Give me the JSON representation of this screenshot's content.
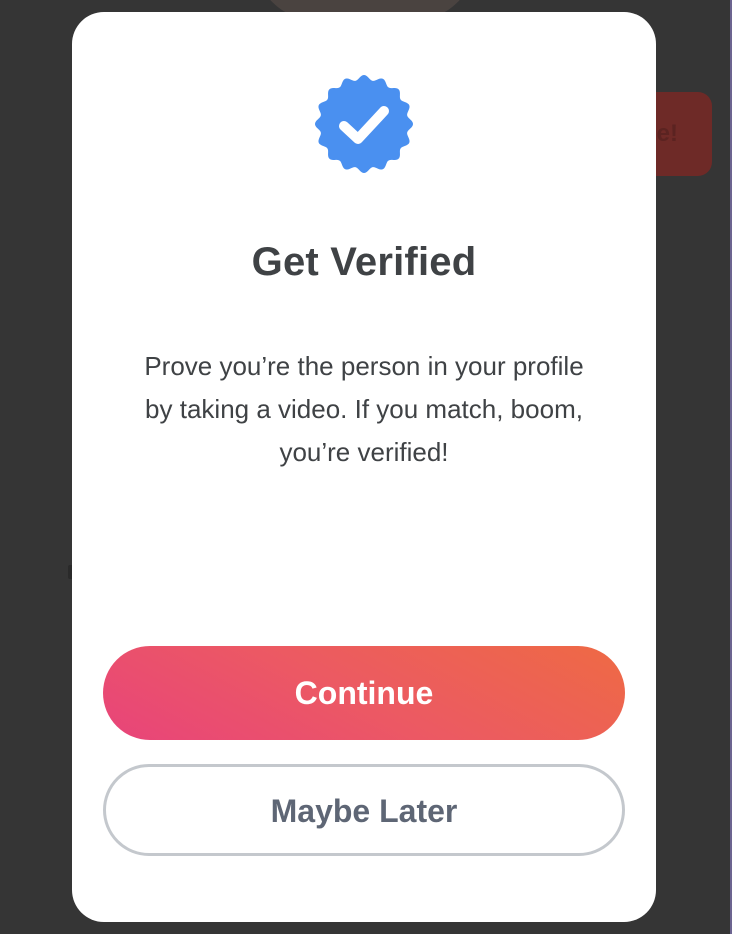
{
  "background": {
    "partial_button_text": "e!"
  },
  "modal": {
    "badge_icon": "verified-badge-icon",
    "badge_color": "#4a90f0",
    "title": "Get Verified",
    "description": "Prove you’re the person in your profile by taking a video. If you match, boom, you’re verified!",
    "continue_label": "Continue",
    "maybe_later_label": "Maybe Later",
    "continue_gradient": [
      "#e8447a",
      "#ee6a44"
    ]
  }
}
